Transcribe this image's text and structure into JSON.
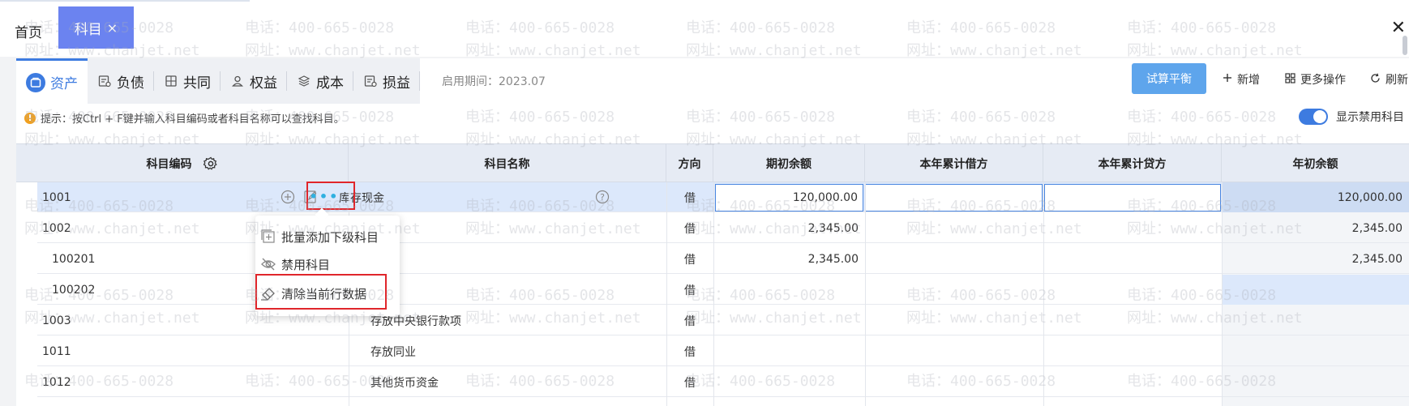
{
  "window": {
    "tabs": [
      {
        "label": "首页",
        "active": false
      },
      {
        "label": "科目",
        "active": true,
        "close": "×"
      }
    ],
    "close_glyph": "✕"
  },
  "category_tabs": [
    {
      "label": "资产",
      "icon": "asset-icon",
      "active": true
    },
    {
      "label": "负债",
      "icon": "liability-icon",
      "active": false
    },
    {
      "label": "共同",
      "icon": "common-icon",
      "active": false
    },
    {
      "label": "权益",
      "icon": "equity-icon",
      "active": false
    },
    {
      "label": "成本",
      "icon": "cost-icon",
      "active": false
    },
    {
      "label": "损益",
      "icon": "profit-loss-icon",
      "active": false
    }
  ],
  "period": "启用期间：2023.07",
  "toolbar": {
    "trial_balance": "试算平衡",
    "add": "新增",
    "more_ops": "更多操作",
    "refresh": "刷新"
  },
  "hint": "提示：按Ctrl + F键并输入科目编码或者科目名称可以查找科目。",
  "show_disabled": {
    "label": "显示禁用科目",
    "on": true
  },
  "table": {
    "headers": {
      "code": "科目编码",
      "name": "科目名称",
      "direction": "方向",
      "opening": "期初余额",
      "debit_ytd": "本年累计借方",
      "credit_ytd": "本年累计贷方",
      "year_start": "年初余额"
    },
    "rows": [
      {
        "code": "1001",
        "name": "库存现金",
        "direction": "借",
        "opening": "120,000.00",
        "debit": "",
        "credit": "",
        "year_start": "120,000.00"
      },
      {
        "code": "1002",
        "name": "",
        "direction": "借",
        "opening": "2,345.00",
        "debit": "",
        "credit": "",
        "year_start": "2,345.00"
      },
      {
        "code": "100201",
        "name": "",
        "direction": "借",
        "opening": "2,345.00",
        "debit": "",
        "credit": "",
        "year_start": "2,345.00"
      },
      {
        "code": "100202",
        "name": "",
        "direction": "借",
        "opening": "",
        "debit": "",
        "credit": "",
        "year_start": ""
      },
      {
        "code": "1003",
        "name": "存放中央银行款项",
        "direction": "借",
        "opening": "",
        "debit": "",
        "credit": "",
        "year_start": ""
      },
      {
        "code": "1011",
        "name": "存放同业",
        "direction": "借",
        "opening": "",
        "debit": "",
        "credit": "",
        "year_start": ""
      },
      {
        "code": "1012",
        "name": "其他货币资金",
        "direction": "借",
        "opening": "",
        "debit": "",
        "credit": "",
        "year_start": ""
      }
    ],
    "more_glyph": "•••",
    "help_glyph": "?"
  },
  "context_menu": [
    {
      "label": "批量添加下级科目",
      "icon": "batch-add-icon"
    },
    {
      "label": "禁用科目",
      "icon": "disable-eye-icon"
    },
    {
      "label": "清除当前行数据",
      "icon": "clear-eraser-icon"
    }
  ],
  "watermark": {
    "phone": "电话：400-665-0028",
    "site": "网址：www.chanjet.net"
  },
  "colors": {
    "accent": "#3d7be0",
    "tab_active": "#6b83f0",
    "highlight": "#e0262b",
    "button": "#5ea5ec"
  }
}
